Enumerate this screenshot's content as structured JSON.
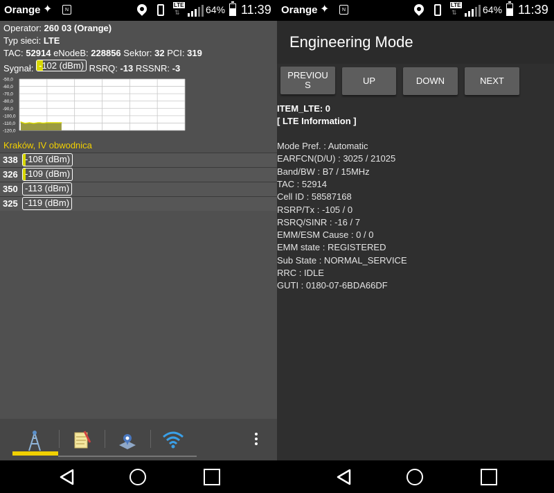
{
  "status_bar": {
    "carrier": "Orange",
    "lte": "LTE",
    "battery": "64%",
    "battery_level": 0.64,
    "time": "11:39"
  },
  "left": {
    "operator_label": "Operator:",
    "operator_value": "260 03 (Orange)",
    "network_label": "Typ sieci:",
    "network_value": "LTE",
    "tac_label": "TAC:",
    "tac_value": "52914",
    "enodeb_label": "eNodeB:",
    "enodeb_value": "228856",
    "sector_label": "Sektor:",
    "sector_value": "32",
    "pci_label": "PCI:",
    "pci_value": "319",
    "signal_label": "Sygnał:",
    "signal_value": "-102 (dBm)",
    "signal_level": 0.12,
    "rsrq_label": "RSRQ:",
    "rsrq_value": "-13",
    "rssnr_label": "RSSNR:",
    "rssnr_value": "-3",
    "area_title": "Kraków, IV obwodnica",
    "neighbors": [
      {
        "pci": "338",
        "signal": "-108 (dBm)",
        "level": 0.06
      },
      {
        "pci": "326",
        "signal": "-109 (dBm)",
        "level": 0.05
      },
      {
        "pci": "350",
        "signal": "-113 (dBm)",
        "level": 0.0
      },
      {
        "pci": "325",
        "signal": "-119 (dBm)",
        "level": 0.0
      }
    ],
    "tabs": [
      "cell-tower-icon",
      "notepad-icon",
      "map-icon",
      "wifi-icon"
    ]
  },
  "chart_data": {
    "type": "area",
    "ylim": [
      -120,
      -50
    ],
    "y_ticks": [
      "-50,0",
      "-60,0",
      "-70,0",
      "-80,0",
      "-90,0",
      "-100,0",
      "-110,0",
      "-120,0"
    ],
    "x_points": 20,
    "series": [
      {
        "values": [
          -108.5,
          -109.5,
          -110.5,
          -110,
          -109.5,
          -110,
          -110.5,
          -110,
          -109.5,
          -109.5,
          -110,
          -110,
          -109.5,
          -109.5,
          -109.5,
          -109.5,
          -109.5,
          -109.5,
          -109.5,
          -109.5
        ]
      }
    ],
    "fill": "#8a8a1e",
    "line": "#e0e000",
    "grid": true
  },
  "right": {
    "title": "Engineering Mode",
    "buttons": {
      "previous": "PREVIOUS",
      "up": "UP",
      "down": "DOWN",
      "next": "NEXT"
    },
    "item_label": "ITEM_LTE: 0",
    "section_label": "[ LTE Information ]",
    "lines": [
      "Mode Pref. : Automatic",
      "EARFCN(D/U) :  3025 / 21025",
      "Band/BW :  B7 / 15MHz",
      "TAC :  52914",
      "Cell ID :  58587168",
      "RSRP/Tx :  -105 / 0",
      "RSRQ/SINR :  -16 / 7",
      "EMM/ESM Cause :  0 / 0",
      "EMM state :  REGISTERED",
      "Sub State :  NORMAL_SERVICE",
      "RRC :  IDLE",
      "GUTI :  0180-07-6BDA66DF"
    ]
  }
}
